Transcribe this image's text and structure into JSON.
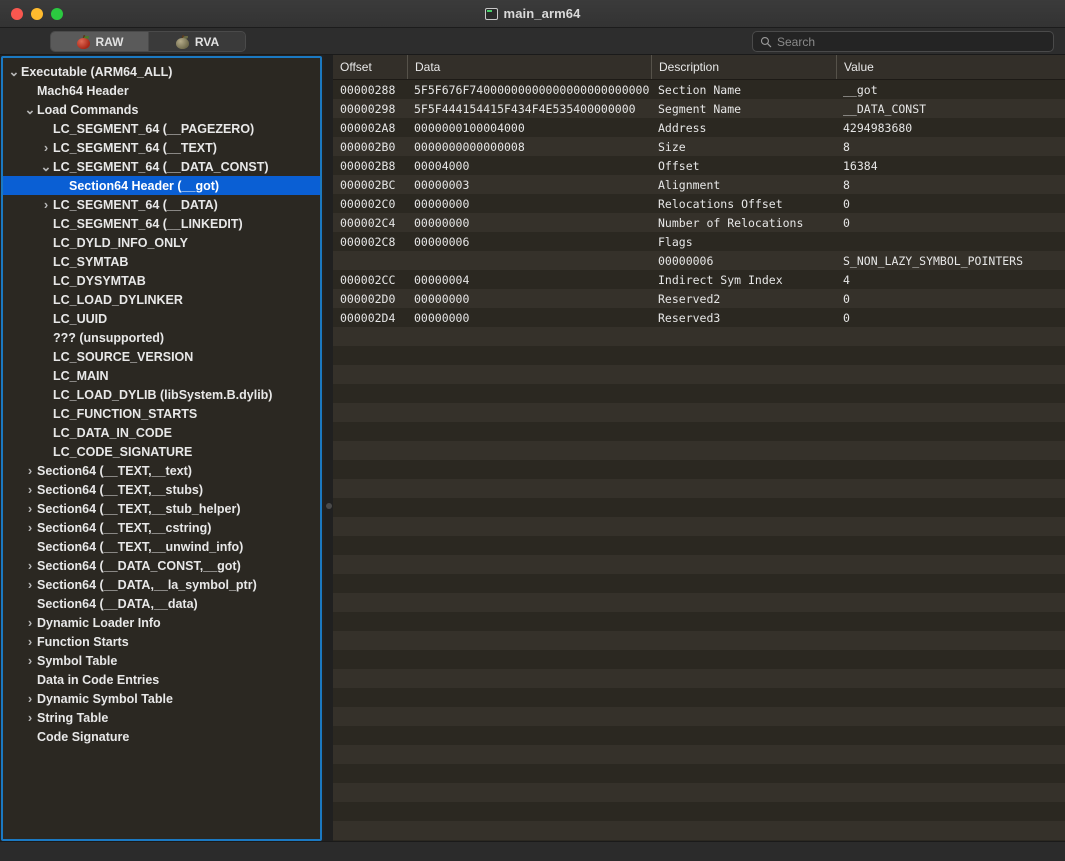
{
  "window": {
    "title": "main_arm64",
    "title_icon": "terminal-doc-icon",
    "traffic_lights": [
      "close",
      "minimize",
      "zoom"
    ],
    "colors": {
      "accent_selection": "#0a5fd4",
      "focus_ring": "#1b79c2",
      "row_odd": "#2b2821",
      "row_even": "#35312a",
      "titlebar": "#363636"
    }
  },
  "toolbar": {
    "tabs": [
      {
        "label": "RAW",
        "icon": "red-apple-icon",
        "active": true
      },
      {
        "label": "RVA",
        "icon": "grey-apple-icon",
        "active": false
      }
    ],
    "search": {
      "placeholder": "Search",
      "value": "",
      "icon": "search-icon"
    }
  },
  "sidebar": {
    "items": [
      {
        "label": "Executable  (ARM64_ALL)",
        "indent": 0,
        "disclosure": "open"
      },
      {
        "label": "Mach64 Header",
        "indent": 1,
        "disclosure": "none"
      },
      {
        "label": "Load Commands",
        "indent": 1,
        "disclosure": "open"
      },
      {
        "label": "LC_SEGMENT_64 (__PAGEZERO)",
        "indent": 2,
        "disclosure": "none"
      },
      {
        "label": "LC_SEGMENT_64 (__TEXT)",
        "indent": 2,
        "disclosure": "closed"
      },
      {
        "label": "LC_SEGMENT_64 (__DATA_CONST)",
        "indent": 2,
        "disclosure": "open"
      },
      {
        "label": "Section64 Header (__got)",
        "indent": 3,
        "disclosure": "none",
        "selected": true
      },
      {
        "label": "LC_SEGMENT_64 (__DATA)",
        "indent": 2,
        "disclosure": "closed"
      },
      {
        "label": "LC_SEGMENT_64 (__LINKEDIT)",
        "indent": 2,
        "disclosure": "none"
      },
      {
        "label": "LC_DYLD_INFO_ONLY",
        "indent": 2,
        "disclosure": "none"
      },
      {
        "label": "LC_SYMTAB",
        "indent": 2,
        "disclosure": "none"
      },
      {
        "label": "LC_DYSYMTAB",
        "indent": 2,
        "disclosure": "none"
      },
      {
        "label": "LC_LOAD_DYLINKER",
        "indent": 2,
        "disclosure": "none"
      },
      {
        "label": "LC_UUID",
        "indent": 2,
        "disclosure": "none"
      },
      {
        "label": "??? (unsupported)",
        "indent": 2,
        "disclosure": "none"
      },
      {
        "label": "LC_SOURCE_VERSION",
        "indent": 2,
        "disclosure": "none"
      },
      {
        "label": "LC_MAIN",
        "indent": 2,
        "disclosure": "none"
      },
      {
        "label": "LC_LOAD_DYLIB (libSystem.B.dylib)",
        "indent": 2,
        "disclosure": "none"
      },
      {
        "label": "LC_FUNCTION_STARTS",
        "indent": 2,
        "disclosure": "none"
      },
      {
        "label": "LC_DATA_IN_CODE",
        "indent": 2,
        "disclosure": "none"
      },
      {
        "label": "LC_CODE_SIGNATURE",
        "indent": 2,
        "disclosure": "none"
      },
      {
        "label": "Section64 (__TEXT,__text)",
        "indent": 1,
        "disclosure": "closed"
      },
      {
        "label": "Section64 (__TEXT,__stubs)",
        "indent": 1,
        "disclosure": "closed"
      },
      {
        "label": "Section64 (__TEXT,__stub_helper)",
        "indent": 1,
        "disclosure": "closed"
      },
      {
        "label": "Section64 (__TEXT,__cstring)",
        "indent": 1,
        "disclosure": "closed"
      },
      {
        "label": "Section64 (__TEXT,__unwind_info)",
        "indent": 1,
        "disclosure": "none"
      },
      {
        "label": "Section64 (__DATA_CONST,__got)",
        "indent": 1,
        "disclosure": "closed"
      },
      {
        "label": "Section64 (__DATA,__la_symbol_ptr)",
        "indent": 1,
        "disclosure": "closed"
      },
      {
        "label": "Section64 (__DATA,__data)",
        "indent": 1,
        "disclosure": "none"
      },
      {
        "label": "Dynamic Loader Info",
        "indent": 1,
        "disclosure": "closed"
      },
      {
        "label": "Function Starts",
        "indent": 1,
        "disclosure": "closed"
      },
      {
        "label": "Symbol Table",
        "indent": 1,
        "disclosure": "closed"
      },
      {
        "label": "Data in Code Entries",
        "indent": 1,
        "disclosure": "none"
      },
      {
        "label": "Dynamic Symbol Table",
        "indent": 1,
        "disclosure": "closed"
      },
      {
        "label": "String Table",
        "indent": 1,
        "disclosure": "closed"
      },
      {
        "label": "Code Signature",
        "indent": 1,
        "disclosure": "none"
      }
    ]
  },
  "table": {
    "columns": [
      "Offset",
      "Data",
      "Description",
      "Value"
    ],
    "rows": [
      {
        "offset": "00000288",
        "data": "5F5F676F74000000000000000000000000",
        "description": "Section Name",
        "value": "__got"
      },
      {
        "offset": "00000298",
        "data": "5F5F444154415F434F4E535400000000",
        "description": "Segment Name",
        "value": "__DATA_CONST"
      },
      {
        "offset": "000002A8",
        "data": "0000000100004000",
        "description": "Address",
        "value": "4294983680"
      },
      {
        "offset": "000002B0",
        "data": "0000000000000008",
        "description": "Size",
        "value": "8"
      },
      {
        "offset": "000002B8",
        "data": "00004000",
        "description": "Offset",
        "value": "16384"
      },
      {
        "offset": "000002BC",
        "data": "00000003",
        "description": "Alignment",
        "value": "8"
      },
      {
        "offset": "000002C0",
        "data": "00000000",
        "description": "Relocations Offset",
        "value": "0"
      },
      {
        "offset": "000002C4",
        "data": "00000000",
        "description": "Number of Relocations",
        "value": "0"
      },
      {
        "offset": "000002C8",
        "data": "00000006",
        "description": "Flags",
        "value": ""
      },
      {
        "offset": "",
        "data": "",
        "description": "00000006",
        "value": "S_NON_LAZY_SYMBOL_POINTERS"
      },
      {
        "offset": "000002CC",
        "data": "00000004",
        "description": "Indirect Sym Index",
        "value": "4"
      },
      {
        "offset": "000002D0",
        "data": "00000000",
        "description": "Reserved2",
        "value": "0"
      },
      {
        "offset": "000002D4",
        "data": "00000000",
        "description": "Reserved3",
        "value": "0"
      }
    ]
  }
}
